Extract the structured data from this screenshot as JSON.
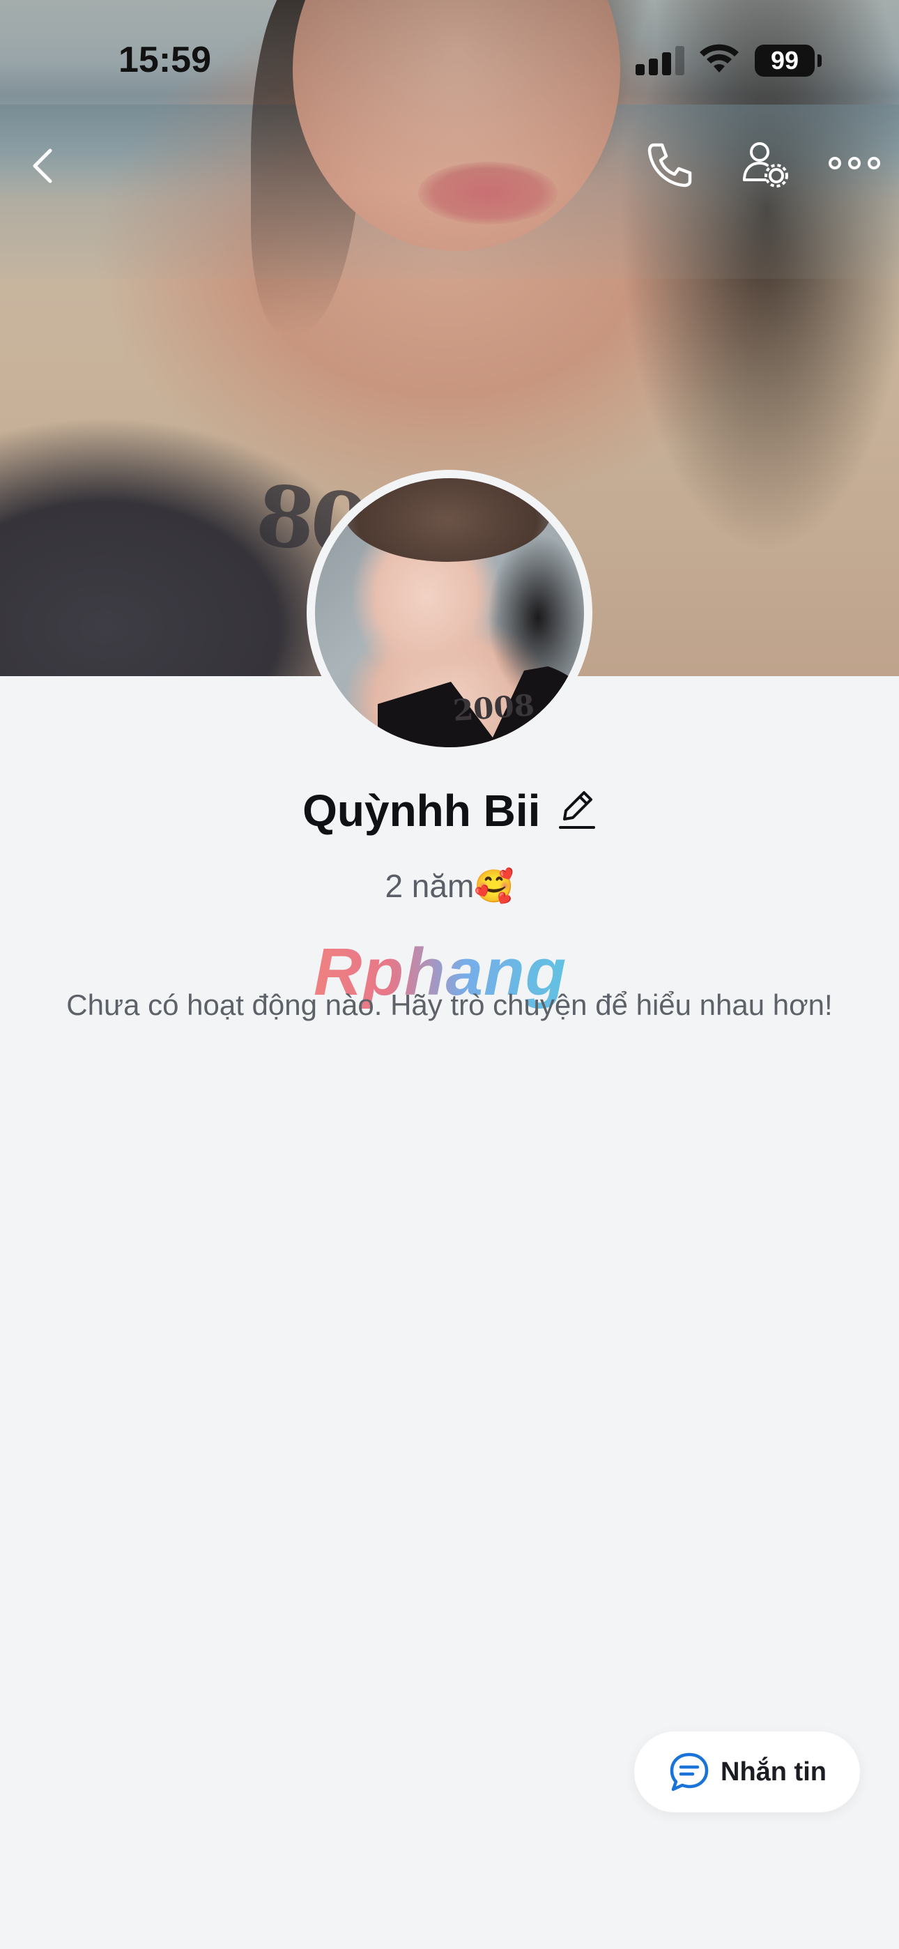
{
  "status_bar": {
    "time": "15:59",
    "battery": "99"
  },
  "nav": {
    "back_icon": "chevron-left-icon",
    "call_icon": "phone-icon",
    "settings_icon": "user-settings-icon",
    "more_icon": "more-horizontal-icon"
  },
  "profile": {
    "name": "Quỳnhh Bii",
    "bio": "2 năm🥰",
    "cover_tattoo": "808",
    "avatar_tattoo": "2008"
  },
  "watermark": "Rphang",
  "activity": {
    "empty_message": "Chưa có hoạt động nào. Hãy trò chuyện để hiểu nhau hơn!"
  },
  "message_button": {
    "label": "Nhắn tin",
    "icon": "chat-bubble-icon"
  },
  "colors": {
    "background": "#f3f4f6",
    "accent": "#1a73d9",
    "text_primary": "#101114",
    "text_secondary": "#5a5e66"
  }
}
